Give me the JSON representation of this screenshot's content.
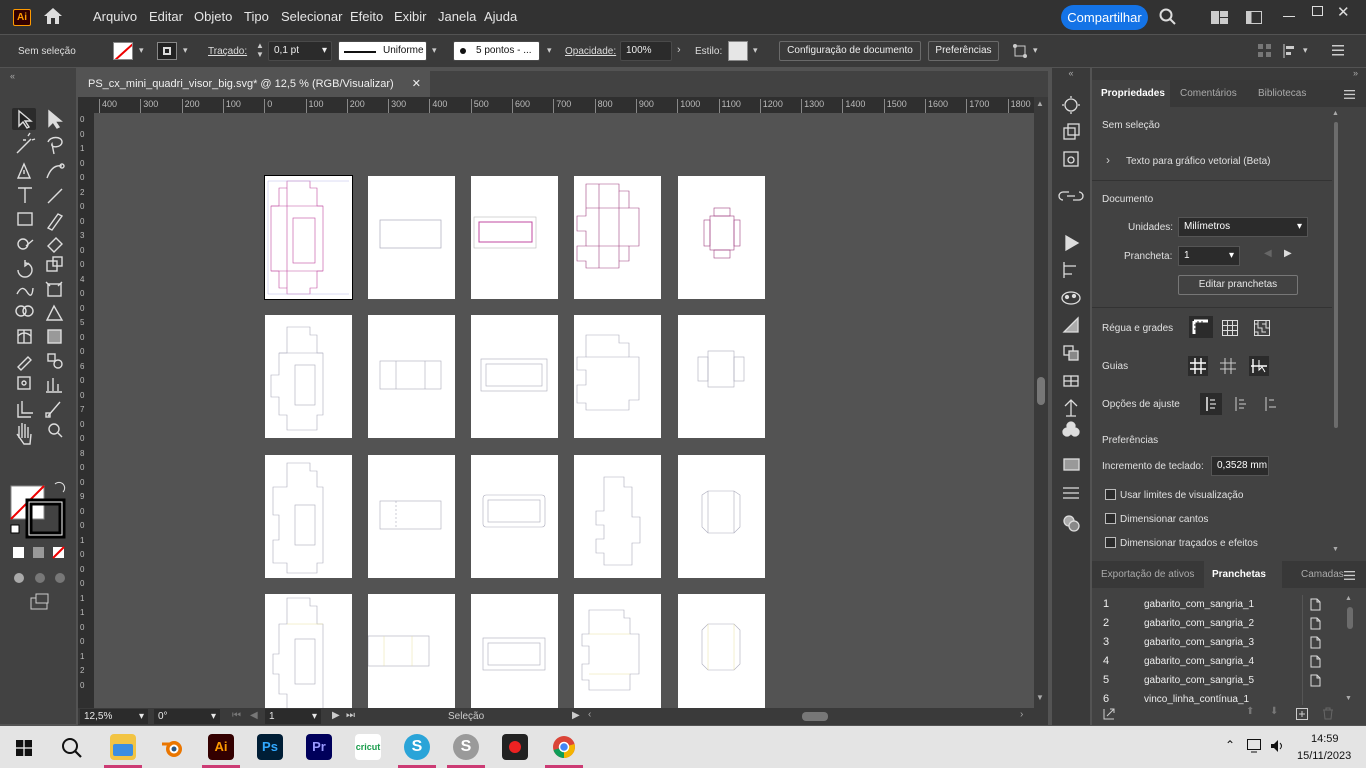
{
  "app": {
    "logo": "Ai"
  },
  "menu": [
    "Arquivo",
    "Editar",
    "Objeto",
    "Tipo",
    "Selecionar",
    "Efeito",
    "Exibir",
    "Janela",
    "Ajuda"
  ],
  "share_label": "Compartilhar",
  "control_bar": {
    "selection": "Sem seleção",
    "stroke_label": "Traçado:",
    "stroke_weight": "0,1 pt",
    "profile": "Uniforme",
    "brush": "5 pontos - ...",
    "opacity_label": "Opacidade:",
    "opacity": "100%",
    "style_label": "Estilo:",
    "doc_setup": "Configuração de documento",
    "prefs": "Preferências"
  },
  "document_tab": {
    "title": "PS_cx_mini_quadri_visor_big.svg* @ 12,5 % (RGB/Visualizar)",
    "close": "✕"
  },
  "ruler": {
    "h_ticks": [
      "400",
      "300",
      "200",
      "100",
      "0",
      "100",
      "200",
      "300",
      "400",
      "500",
      "600",
      "700",
      "800",
      "900",
      "1000",
      "1100",
      "1200",
      "1300",
      "1400",
      "1500",
      "1600",
      "1700",
      "1800"
    ],
    "v_ticks": [
      "0",
      "0",
      "1",
      "0",
      "0",
      "2",
      "0",
      "0",
      "3",
      "0",
      "0",
      "4",
      "0",
      "0",
      "5",
      "0",
      "0",
      "6",
      "0",
      "0",
      "7",
      "0",
      "0",
      "8",
      "0",
      "0",
      "9",
      "0",
      "0",
      "1",
      "0",
      "0",
      "0",
      "1",
      "1",
      "0",
      "0",
      "1",
      "2",
      "0"
    ]
  },
  "status": {
    "zoom": "12,5%",
    "rotation": "0°",
    "artboard": "1",
    "mode": "Seleção"
  },
  "panel": {
    "tabs": [
      "Propriedades",
      "Comentários",
      "Bibliotecas"
    ],
    "no_selection": "Sem seleção",
    "vector_text": "Texto para gráfico vetorial (Beta)",
    "document": "Documento",
    "units_label": "Unidades:",
    "units": "Milímetros",
    "artboard_label": "Prancheta:",
    "artboard": "1",
    "edit_artboards": "Editar pranchetas",
    "rulers_grids": "Régua e grades",
    "guides": "Guias",
    "snap": "Opções de ajuste",
    "preferences": "Preferências",
    "keyboard_inc_label": "Incremento de teclado:",
    "keyboard_inc": "0,3528 mm",
    "check1": "Usar limites de visualização",
    "check2": "Dimensionar cantos",
    "check3": "Dimensionar traçados e efeitos"
  },
  "artboard_panel": {
    "tabs": [
      "Exportação de ativos",
      "Pranchetas",
      "Camadas"
    ],
    "rows": [
      {
        "n": "1",
        "name": "gabarito_com_sangria_1"
      },
      {
        "n": "2",
        "name": "gabarito_com_sangria_2"
      },
      {
        "n": "3",
        "name": "gabarito_com_sangria_3"
      },
      {
        "n": "4",
        "name": "gabarito_com_sangria_4"
      },
      {
        "n": "5",
        "name": "gabarito_com_sangria_5"
      },
      {
        "n": "6",
        "name": "vinco_linha_contínua_1"
      }
    ]
  },
  "taskbar": {
    "time": "14:59",
    "date": "15/11/2023",
    "apps": [
      "explorer",
      "blender",
      "illustrator",
      "photoshop",
      "premiere",
      "cricut",
      "silhouette",
      "silhouette-studio",
      "recorder",
      "chrome"
    ]
  },
  "colors": {
    "accent": "#1473e6",
    "ai_orange": "#ff9a00",
    "ai_bg": "#330000",
    "ps_blue": "#31a8ff",
    "pr_purple": "#9999ff",
    "cut_magenta": "#c04aa0",
    "crease": "#b8b8e8"
  }
}
